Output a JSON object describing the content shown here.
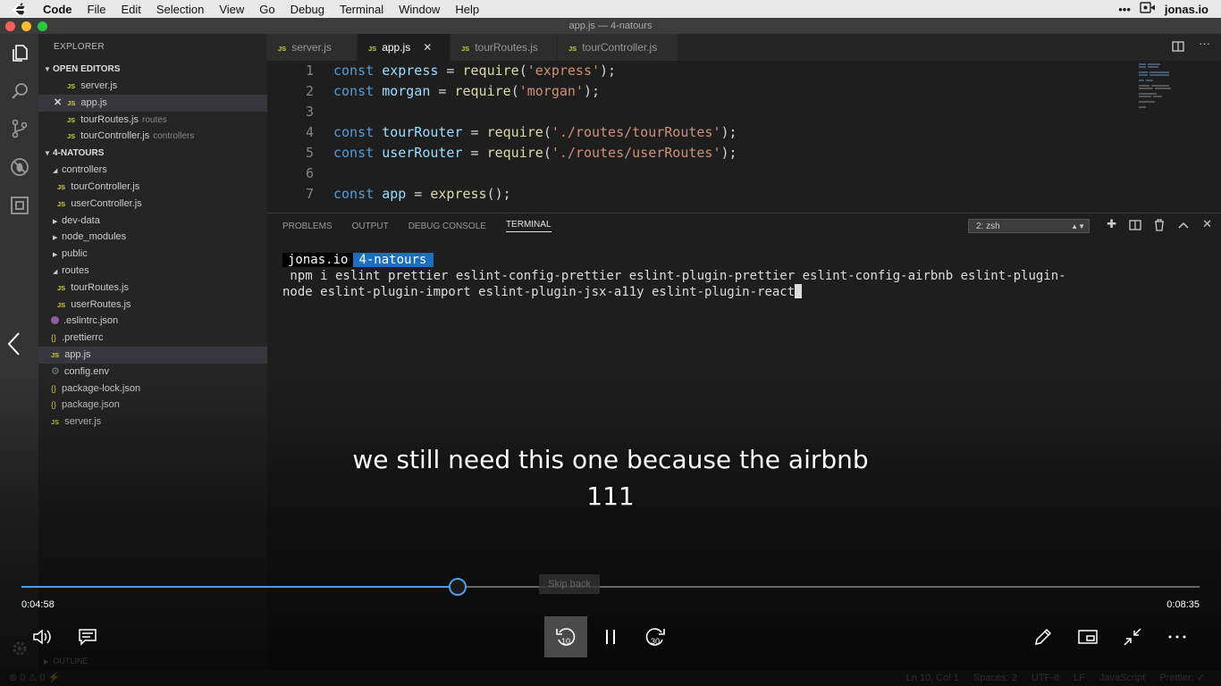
{
  "menubar": {
    "items": [
      "Code",
      "File",
      "Edit",
      "Selection",
      "View",
      "Go",
      "Debug",
      "Terminal",
      "Window",
      "Help"
    ],
    "user": "jonas.io",
    "more": "•••"
  },
  "window": {
    "title": "app.js — 4-natours"
  },
  "sidebar": {
    "title": "EXPLORER",
    "open_editors_header": "OPEN EDITORS",
    "open_editors": [
      {
        "name": "server.js",
        "desc": ""
      },
      {
        "name": "app.js",
        "desc": ""
      },
      {
        "name": "tourRoutes.js",
        "desc": "routes"
      },
      {
        "name": "tourController.js",
        "desc": "controllers"
      }
    ],
    "project_header": "4-NATOURS",
    "tree": [
      "controllers",
      "tourController.js",
      "userController.js",
      "dev-data",
      "node_modules",
      "public",
      "routes",
      "tourRoutes.js",
      "userRoutes.js",
      ".eslintrc.json",
      ".prettierrc",
      "app.js",
      "config.env",
      "package-lock.json",
      "package.json",
      "server.js"
    ],
    "outline_header": "OUTLINE"
  },
  "tabs": [
    "server.js",
    "app.js",
    "tourRoutes.js",
    "tourController.js"
  ],
  "editor": {
    "line_numbers": [
      "1",
      "2",
      "3",
      "4",
      "5",
      "6",
      "7"
    ]
  },
  "panel": {
    "tabs": [
      "PROBLEMS",
      "OUTPUT",
      "DEBUG CONSOLE",
      "TERMINAL"
    ],
    "terminal_select": "2: zsh",
    "prompt_user": "jonas.io",
    "prompt_dir": "4-natours",
    "command_line1": " npm i eslint prettier eslint-config-prettier eslint-plugin-prettier eslint-config-airbnb eslint-plugin-",
    "command_line2": "node eslint-plugin-import eslint-plugin-jsx-a11y eslint-plugin-react"
  },
  "statusbar": {
    "left": "⊗ 0 ⚠ 0 ⚡",
    "position": "Ln 10, Col 1",
    "spaces": "Spaces: 2",
    "encoding": "UTF-8",
    "eol": "LF",
    "language": "JavaScript",
    "formatter": "Prettier: ✓"
  },
  "video": {
    "caption_line1": "we still need this one because the airbnb",
    "caption_line2": "111",
    "elapsed": "0:04:58",
    "remaining": "0:08:35",
    "progress_fraction": 0.37,
    "skip_tooltip": "Skip back",
    "skip_back_seconds": "10",
    "skip_forward_seconds": "30",
    "accent": "#4a9ff0"
  }
}
